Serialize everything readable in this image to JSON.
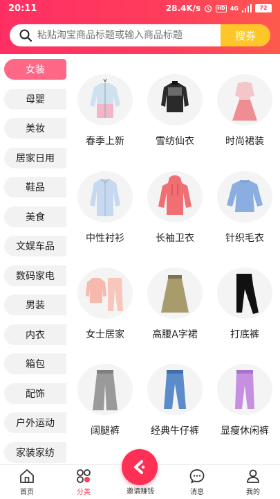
{
  "status_bar": {
    "time": "20:11",
    "speed": "28.4K/s",
    "signal": "4G",
    "battery": "72"
  },
  "search": {
    "placeholder": "粘贴淘宝商品标题或输入商品标题",
    "button_label": "搜券"
  },
  "colors": {
    "brand": "#ff3d5c",
    "accent": "#ffc629",
    "active_category": "#ff6786"
  },
  "sidebar": {
    "items": [
      {
        "label": "女装",
        "active": true
      },
      {
        "label": "母婴"
      },
      {
        "label": "美妆"
      },
      {
        "label": "居家日用"
      },
      {
        "label": "鞋品"
      },
      {
        "label": "美食"
      },
      {
        "label": "文娱车品"
      },
      {
        "label": "数码家电"
      },
      {
        "label": "男装"
      },
      {
        "label": "内衣"
      },
      {
        "label": "箱包"
      },
      {
        "label": "配饰"
      },
      {
        "label": "户外运动"
      },
      {
        "label": "家装家纺"
      }
    ]
  },
  "grid": {
    "items": [
      {
        "label": "春季上新",
        "icon": "jacket-icon"
      },
      {
        "label": "雪纺仙衣",
        "icon": "blouse-icon"
      },
      {
        "label": "时尚裙装",
        "icon": "dress-icon"
      },
      {
        "label": "中性衬衫",
        "icon": "shirt-icon"
      },
      {
        "label": "长袖卫衣",
        "icon": "hoodie-icon"
      },
      {
        "label": "针织毛衣",
        "icon": "sweater-icon"
      },
      {
        "label": "女士居家",
        "icon": "pajamas-icon"
      },
      {
        "label": "高腰A字裙",
        "icon": "skirt-icon"
      },
      {
        "label": "打底裤",
        "icon": "leggings-icon"
      },
      {
        "label": "阔腿裤",
        "icon": "wide-pants-icon"
      },
      {
        "label": "经典牛仔裤",
        "icon": "jeans-icon"
      },
      {
        "label": "显瘦休闲裤",
        "icon": "casual-pants-icon"
      }
    ]
  },
  "bottom_nav": {
    "items": [
      {
        "label": "首页",
        "icon": "home-icon"
      },
      {
        "label": "分类",
        "icon": "category-icon",
        "active": true
      },
      {
        "label": "邀请赚钱",
        "icon": "invite-icon"
      },
      {
        "label": "消息",
        "icon": "message-icon"
      },
      {
        "label": "我的",
        "icon": "profile-icon"
      }
    ]
  }
}
